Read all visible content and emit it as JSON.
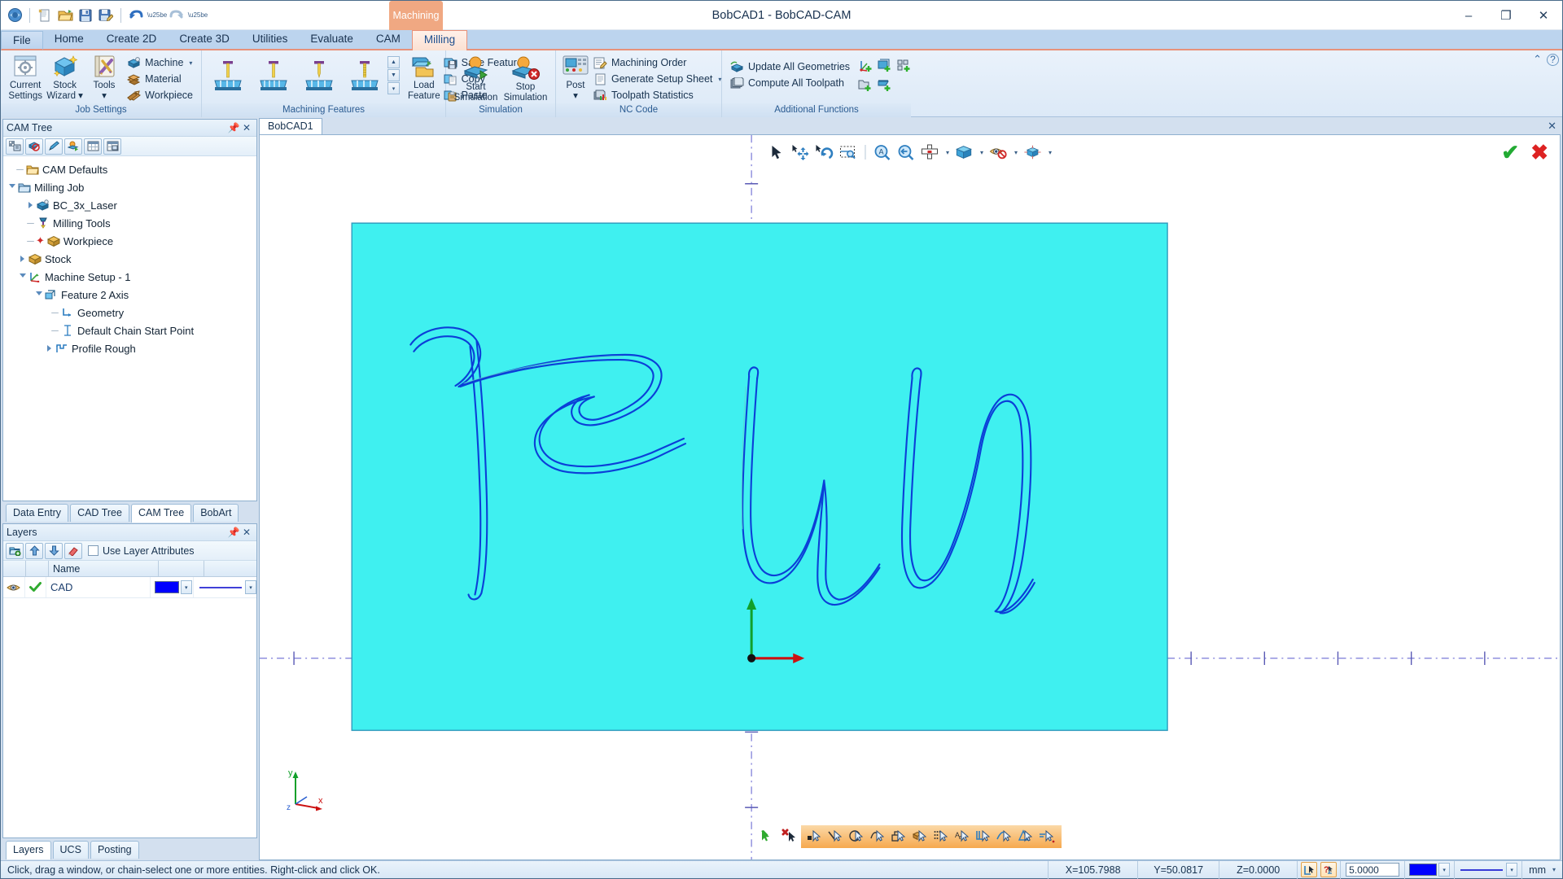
{
  "window": {
    "title": "BobCAD1 - BobCAD-CAM",
    "minimize": "–",
    "maximize": "❐",
    "close": "✕"
  },
  "quick_access": [
    {
      "name": "app-menu-icon",
      "glyph": "◐"
    },
    {
      "name": "new-icon",
      "glyph": "🗋"
    },
    {
      "name": "open-icon",
      "glyph": "📂"
    },
    {
      "name": "save-icon",
      "glyph": "💾"
    },
    {
      "name": "save-as-icon",
      "glyph": "💾"
    },
    {
      "name": "undo-icon",
      "glyph": "↶"
    },
    {
      "name": "redo-icon",
      "glyph": "↷"
    }
  ],
  "ribbon": {
    "context_group": "Machining",
    "tabs": [
      {
        "label": "File",
        "selected": true,
        "kind": "file"
      },
      {
        "label": "Home",
        "selected": false,
        "kind": "normal"
      },
      {
        "label": "Create 2D",
        "selected": false,
        "kind": "normal"
      },
      {
        "label": "Create 3D",
        "selected": false,
        "kind": "normal"
      },
      {
        "label": "Utilities",
        "selected": false,
        "kind": "normal"
      },
      {
        "label": "Evaluate",
        "selected": false,
        "kind": "normal"
      },
      {
        "label": "CAM",
        "selected": false,
        "kind": "normal"
      },
      {
        "label": "Milling",
        "selected": true,
        "kind": "context"
      }
    ],
    "groups": [
      {
        "title": "Job Settings",
        "big": [
          {
            "label": "Current\nSettings",
            "label_l1": "Current",
            "label_l2": "Settings",
            "icon": "gear-window-icon"
          },
          {
            "label": "Stock Wizard",
            "label_l1": "Stock",
            "label_l2": "Wizard ▾",
            "icon": "stock-wizard-icon"
          },
          {
            "label": "Tools",
            "label_l1": "Tools",
            "label_l2": "▾",
            "icon": "tools-icon"
          }
        ],
        "small": [
          {
            "label": "Machine",
            "icon": "machine-icon",
            "has_caret": true
          },
          {
            "label": "Material",
            "icon": "material-icon",
            "has_caret": false
          },
          {
            "label": "Workpiece",
            "icon": "workpiece-icon",
            "has_caret": false
          }
        ]
      },
      {
        "title": "Machining Features",
        "features": [
          {
            "name": "feature-profile"
          },
          {
            "name": "feature-pocket"
          },
          {
            "name": "feature-drill"
          },
          {
            "name": "feature-thread"
          }
        ],
        "spin": [
          "▲",
          "▼",
          "▾"
        ]
      },
      {
        "title": "",
        "big": [
          {
            "label_l1": "Load",
            "label_l2": "Feature",
            "icon": "load-feature-icon"
          }
        ],
        "small": [
          {
            "label": "Save Feature",
            "icon": "save-feature-icon",
            "has_caret": false
          },
          {
            "label": "Copy",
            "icon": "copy-icon",
            "has_caret": false
          },
          {
            "label": "Paste",
            "icon": "paste-icon",
            "has_caret": false
          }
        ]
      },
      {
        "title": "Simulation",
        "big": [
          {
            "label_l1": "Start",
            "label_l2": "Simulation",
            "icon": "start-simulation-icon"
          },
          {
            "label_l1": "Stop",
            "label_l2": "Simulation",
            "icon": "stop-simulation-icon"
          }
        ]
      },
      {
        "title": "NC Code",
        "big": [
          {
            "label_l1": "Post",
            "label_l2": "▾",
            "icon": "post-icon"
          }
        ],
        "small": [
          {
            "label": "Machining Order",
            "icon": "machining-order-icon",
            "has_caret": false
          },
          {
            "label": "Generate Setup Sheet",
            "icon": "setup-sheet-icon",
            "has_caret": true
          },
          {
            "label": "Toolpath Statistics",
            "icon": "toolpath-statistics-icon",
            "has_caret": false
          }
        ]
      },
      {
        "title": "Additional Functions",
        "small": [
          {
            "label": "Update All Geometries",
            "icon": "update-geometries-icon",
            "has_caret": false
          },
          {
            "label": "Compute All Toolpath",
            "icon": "compute-toolpath-icon",
            "has_caret": false
          }
        ],
        "mini": [
          {
            "name": "add-machine-setup-icon"
          },
          {
            "name": "add-feature-icon"
          },
          {
            "name": "add-group-icon"
          },
          {
            "name": "add-folder-icon"
          },
          {
            "name": "add-plane-icon"
          }
        ]
      }
    ],
    "help_icons": [
      {
        "name": "collapse-ribbon-icon",
        "glyph": "⌃"
      },
      {
        "name": "help-icon",
        "glyph": "?"
      }
    ]
  },
  "cam_tree": {
    "panel_title": "CAM Tree",
    "pin_glyph": "⚓",
    "close_glyph": "✕",
    "toolbar": [
      {
        "name": "cam-tree-tool-defaults"
      },
      {
        "name": "cam-tree-tool-hide"
      },
      {
        "name": "cam-tree-tool-pen"
      },
      {
        "name": "cam-tree-tool-simulate"
      },
      {
        "name": "cam-tree-tool-grid"
      },
      {
        "name": "cam-tree-tool-report"
      }
    ],
    "nodes": [
      {
        "label": "CAM Defaults",
        "indent": 1,
        "expander": "none",
        "icon": "folder-icon"
      },
      {
        "label": "Milling Job",
        "indent": 1,
        "expander": "open",
        "icon": "job-folder-icon"
      },
      {
        "label": "BC_3x_Laser",
        "indent": 2,
        "expander": "closed",
        "icon": "machine-icon"
      },
      {
        "label": "Milling Tools",
        "indent": 2,
        "expander": "none",
        "icon": "tool-icon"
      },
      {
        "label": "Workpiece",
        "indent": 2,
        "expander": "none",
        "icon": "workpiece-cube-icon"
      },
      {
        "label": "Stock",
        "indent": 1.6,
        "expander": "closed",
        "icon": "stock-cube-icon"
      },
      {
        "label": "Machine Setup - 1",
        "indent": 1.6,
        "expander": "open",
        "icon": "machine-setup-icon"
      },
      {
        "label": "Feature 2 Axis",
        "indent": 2.5,
        "expander": "open",
        "icon": "feature-icon"
      },
      {
        "label": "Geometry",
        "indent": 3.4,
        "expander": "none",
        "icon": "geometry-icon"
      },
      {
        "label": "Default Chain Start Point",
        "indent": 3.4,
        "expander": "none",
        "icon": "chain-start-icon"
      },
      {
        "label": "Profile Rough",
        "indent": 3.1,
        "expander": "closed",
        "icon": "profile-rough-icon"
      }
    ]
  },
  "dock_tabs": [
    {
      "label": "Data Entry",
      "selected": false
    },
    {
      "label": "CAD Tree",
      "selected": false
    },
    {
      "label": "CAM Tree",
      "selected": true
    },
    {
      "label": "BobArt",
      "selected": false
    }
  ],
  "layers": {
    "panel_title": "Layers",
    "pin_glyph": "⚓",
    "close_glyph": "✕",
    "toolbar": [
      {
        "name": "add-layer-icon"
      },
      {
        "name": "move-layer-up-icon"
      },
      {
        "name": "move-layer-down-icon"
      },
      {
        "name": "delete-layer-icon"
      }
    ],
    "checkbox_label": "Use Layer Attributes",
    "checkbox_checked": false,
    "columns": [
      "",
      "",
      "Name",
      "",
      ""
    ],
    "rows": [
      {
        "visible": true,
        "active": true,
        "name": "CAD",
        "color": "#0000ff",
        "linestyle": "solid"
      }
    ]
  },
  "bottom_tabs": [
    {
      "label": "Layers",
      "selected": true
    },
    {
      "label": "UCS",
      "selected": false
    },
    {
      "label": "Posting",
      "selected": false
    }
  ],
  "document": {
    "tab_label": "BobCAD1",
    "close_glyph": "✕"
  },
  "viewport_toolbar": [
    {
      "name": "select-arrow-icon",
      "caret": false
    },
    {
      "name": "pan-icon",
      "caret": false
    },
    {
      "name": "rotate-icon",
      "caret": false
    },
    {
      "name": "zoom-window-icon",
      "caret": false
    },
    {
      "name": "zoom-all-icon",
      "caret": false
    },
    {
      "name": "zoom-previous-icon",
      "caret": false
    },
    {
      "name": "view-plane-icon",
      "caret": true
    },
    {
      "name": "shade-cube-icon",
      "caret": true
    },
    {
      "name": "hide-show-icon",
      "caret": true
    },
    {
      "name": "view-orientation-icon",
      "caret": true
    }
  ],
  "viewport_confirm": [
    {
      "name": "accept-check-icon",
      "glyph": "✔",
      "color": "#22aa33"
    },
    {
      "name": "cancel-x-icon",
      "glyph": "✖",
      "color": "#dd2222"
    }
  ],
  "snap_toolbar": {
    "standalone": [
      {
        "name": "snap-accept-icon"
      },
      {
        "name": "snap-cancel-icon"
      }
    ],
    "snaps": [
      {
        "name": "snap-point-icon"
      },
      {
        "name": "snap-endpoint-icon"
      },
      {
        "name": "snap-center-icon"
      },
      {
        "name": "snap-midpoint-icon"
      },
      {
        "name": "snap-quadrant-icon"
      },
      {
        "name": "snap-entity-icon"
      },
      {
        "name": "snap-grid-icon"
      },
      {
        "name": "snap-text-icon"
      },
      {
        "name": "snap-perpendicular-icon"
      },
      {
        "name": "snap-tangent-icon"
      },
      {
        "name": "snap-intersection-icon"
      },
      {
        "name": "snap-nearest-icon"
      }
    ]
  },
  "drawing": {
    "text": "Run",
    "stock_color": "#3ff0f0",
    "geometry_color": "#0b3fd8",
    "origin_label": "",
    "axis_triad": {
      "x": "x",
      "y": "y",
      "z": "z"
    }
  },
  "statusbar": {
    "message": "Click, drag a window, or chain-select one or more entities. Right-click and click OK.",
    "x": "X=105.7988",
    "y": "Y=50.0817",
    "z": "Z=0.0000",
    "snap_icon": "snap-mode-icon",
    "help_icon": "context-help-icon",
    "thickness": "5.0000",
    "color": "#0000ff",
    "linestyle": "solid",
    "units": "mm",
    "units_caret": "▾"
  }
}
